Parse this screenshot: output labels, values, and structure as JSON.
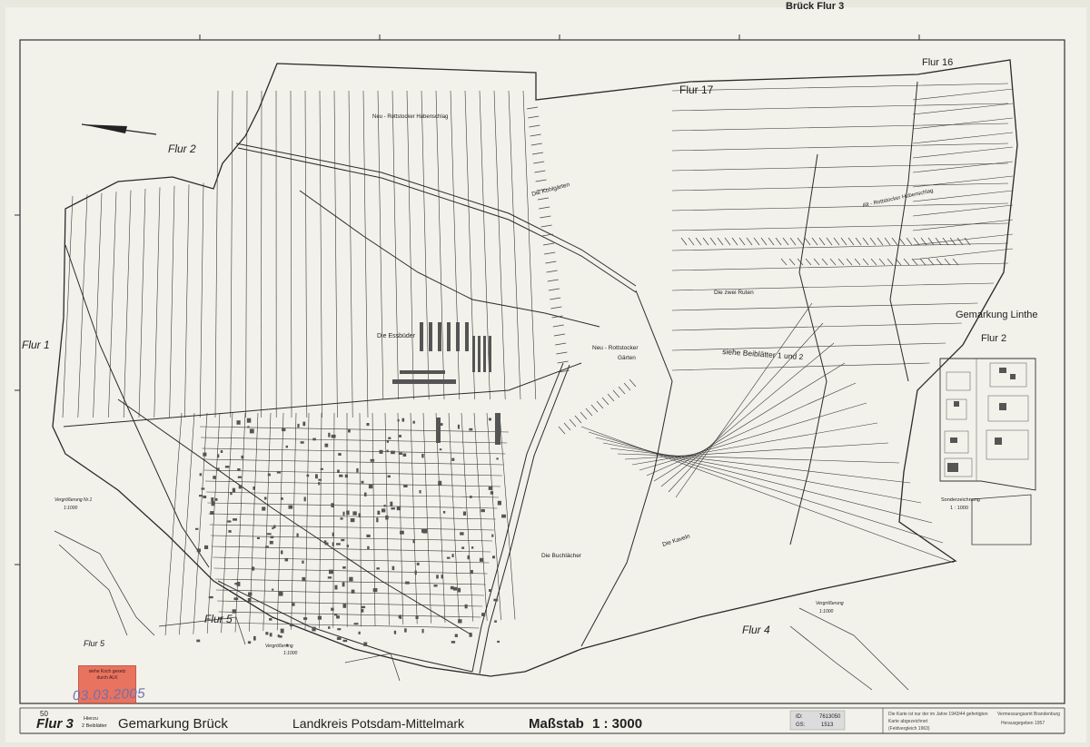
{
  "header": {
    "top_right_label": "Brück  Flur 3"
  },
  "map_labels": {
    "flur2": "Flur 2",
    "flur17": "Flur 17",
    "flur16": "Flur 16",
    "flur1": "Flur 1",
    "flur5": "Flur 5",
    "flur5_small": "Flur 5",
    "flur4": "Flur 4",
    "gem_linthe": "Gemarkung Linthe",
    "linthe_flur2": "Flur 2",
    "neu_rottstocker_hubenschlag": "Neu - Rottstocker Hubenschlag",
    "alt_rottstocker_hubenschlag": "Alt - Rottstocker Hubenschlag",
    "kohlgaerten": "Die Kohlgärten",
    "zwei_ruten": "Die zwei Ruten",
    "essbueder": "Die Essbüder",
    "neu_rottstocker_gaerten_1": "Neu - Rottstocker",
    "neu_rottstocker_gaerten_2": "Gärten",
    "beiblaetter": "siehe Beiblätter 1 und 2",
    "buchlaecher": "Die Buchlächer",
    "kaveln": "Die Kaveln",
    "sonderzeichnung_1": "Sonderzeichnung",
    "sonderzeichnung_2": "1 : 1000",
    "vergroesserung_left": "Vergrößerung Nr.1",
    "vergroesserung_left_scale": "1:1000",
    "vergroesserung_mid": "Vergrößerung",
    "vergroesserung_mid_scale": "1:1000",
    "vergroesserung_right": "Vergrößerung",
    "vergroesserung_right_scale": "1:1000"
  },
  "sticker": {
    "line1": "siehe Koch gesetz",
    "line2": "durch ALK",
    "stamp_date": "03.03.2005"
  },
  "footer": {
    "corner_number": "50",
    "flur": "Flur 3",
    "hierzu_1": "Hierzu",
    "hierzu_2": "2 Beiblätter",
    "gemarkung": "Gemarkung Brück",
    "landkreis": "Landkreis Potsdam-Mittelmark",
    "massstab_label": "Maßstab",
    "massstab_value": "1 : 3000",
    "id_label": "ID:",
    "id_value": "7613050",
    "gs_label": "GS:",
    "gs_value": "1513",
    "note_1": "Die Karte ist nur der im Jahre 1943/44 gefertigten",
    "note_2": "Karte abgezeichnet",
    "note_3": "(Feldvergleich 1963)",
    "note_4": "Vermessungsamt Brandenburg",
    "note_5": "Herausgegeben 1957"
  },
  "colors": {
    "paper": "#f2f1ea",
    "ink": "#2a2a2a",
    "sticker": "#e8735f",
    "stamp": "#6e6fb0"
  }
}
